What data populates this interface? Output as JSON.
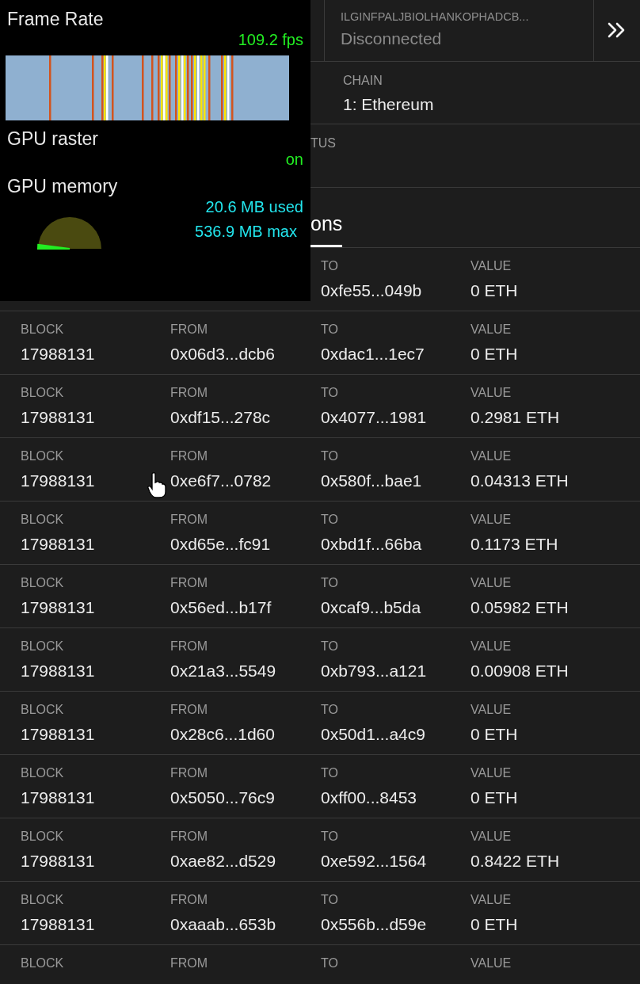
{
  "header": {
    "extension_id": "ILGINFPALJBIOLHANKOPHADCB...",
    "connection_status": "Disconnected"
  },
  "chain": {
    "label": "CHAIN",
    "value": "1: Ethereum"
  },
  "mining_status": {
    "label": "TUS"
  },
  "tabs": [
    {
      "label": "ons",
      "selected": true
    }
  ],
  "transactions": [
    {
      "to": {
        "label": "TO",
        "value": "0xfe55...049b"
      },
      "value": {
        "label": "VALUE",
        "value": "0 ETH"
      }
    },
    {
      "block": {
        "label": "BLOCK",
        "value": "17988131"
      },
      "from": {
        "label": "FROM",
        "value": "0x06d3...dcb6"
      },
      "to": {
        "label": "TO",
        "value": "0xdac1...1ec7"
      },
      "value": {
        "label": "VALUE",
        "value": "0 ETH"
      }
    },
    {
      "block": {
        "label": "BLOCK",
        "value": "17988131"
      },
      "from": {
        "label": "FROM",
        "value": "0xdf15...278c"
      },
      "to": {
        "label": "TO",
        "value": "0x4077...1981"
      },
      "value": {
        "label": "VALUE",
        "value": "0.2981 ETH"
      }
    },
    {
      "block": {
        "label": "BLOCK",
        "value": "17988131"
      },
      "from": {
        "label": "FROM",
        "value": "0xe6f7...0782"
      },
      "to": {
        "label": "TO",
        "value": "0x580f...bae1"
      },
      "value": {
        "label": "VALUE",
        "value": "0.04313 ETH"
      }
    },
    {
      "block": {
        "label": "BLOCK",
        "value": "17988131"
      },
      "from": {
        "label": "FROM",
        "value": "0xd65e...fc91"
      },
      "to": {
        "label": "TO",
        "value": "0xbd1f...66ba"
      },
      "value": {
        "label": "VALUE",
        "value": "0.1173 ETH"
      }
    },
    {
      "block": {
        "label": "BLOCK",
        "value": "17988131"
      },
      "from": {
        "label": "FROM",
        "value": "0x56ed...b17f"
      },
      "to": {
        "label": "TO",
        "value": "0xcaf9...b5da"
      },
      "value": {
        "label": "VALUE",
        "value": "0.05982 ETH"
      }
    },
    {
      "block": {
        "label": "BLOCK",
        "value": "17988131"
      },
      "from": {
        "label": "FROM",
        "value": "0x21a3...5549"
      },
      "to": {
        "label": "TO",
        "value": "0xb793...a121"
      },
      "value": {
        "label": "VALUE",
        "value": "0.00908 ETH"
      }
    },
    {
      "block": {
        "label": "BLOCK",
        "value": "17988131"
      },
      "from": {
        "label": "FROM",
        "value": "0x28c6...1d60"
      },
      "to": {
        "label": "TO",
        "value": "0x50d1...a4c9"
      },
      "value": {
        "label": "VALUE",
        "value": "0 ETH"
      }
    },
    {
      "block": {
        "label": "BLOCK",
        "value": "17988131"
      },
      "from": {
        "label": "FROM",
        "value": "0x5050...76c9"
      },
      "to": {
        "label": "TO",
        "value": "0xff00...8453"
      },
      "value": {
        "label": "VALUE",
        "value": "0 ETH"
      }
    },
    {
      "block": {
        "label": "BLOCK",
        "value": "17988131"
      },
      "from": {
        "label": "FROM",
        "value": "0xae82...d529"
      },
      "to": {
        "label": "TO",
        "value": "0xe592...1564"
      },
      "value": {
        "label": "VALUE",
        "value": "0.8422 ETH"
      }
    },
    {
      "block": {
        "label": "BLOCK",
        "value": "17988131"
      },
      "from": {
        "label": "FROM",
        "value": "0xaaab...653b"
      },
      "to": {
        "label": "TO",
        "value": "0x556b...d59e"
      },
      "value": {
        "label": "VALUE",
        "value": "0 ETH"
      }
    },
    {
      "block": {
        "label": "BLOCK"
      },
      "from": {
        "label": "FROM"
      },
      "to": {
        "label": "TO"
      },
      "value": {
        "label": "VALUE"
      }
    }
  ],
  "hud": {
    "frame_rate": {
      "title": "Frame Rate",
      "reading": "109.2 fps"
    },
    "gpu_raster": {
      "title": "GPU raster",
      "reading": "on"
    },
    "gpu_memory": {
      "title": "GPU memory",
      "used": "20.6 MB used",
      "max": "536.9 MB max"
    }
  }
}
